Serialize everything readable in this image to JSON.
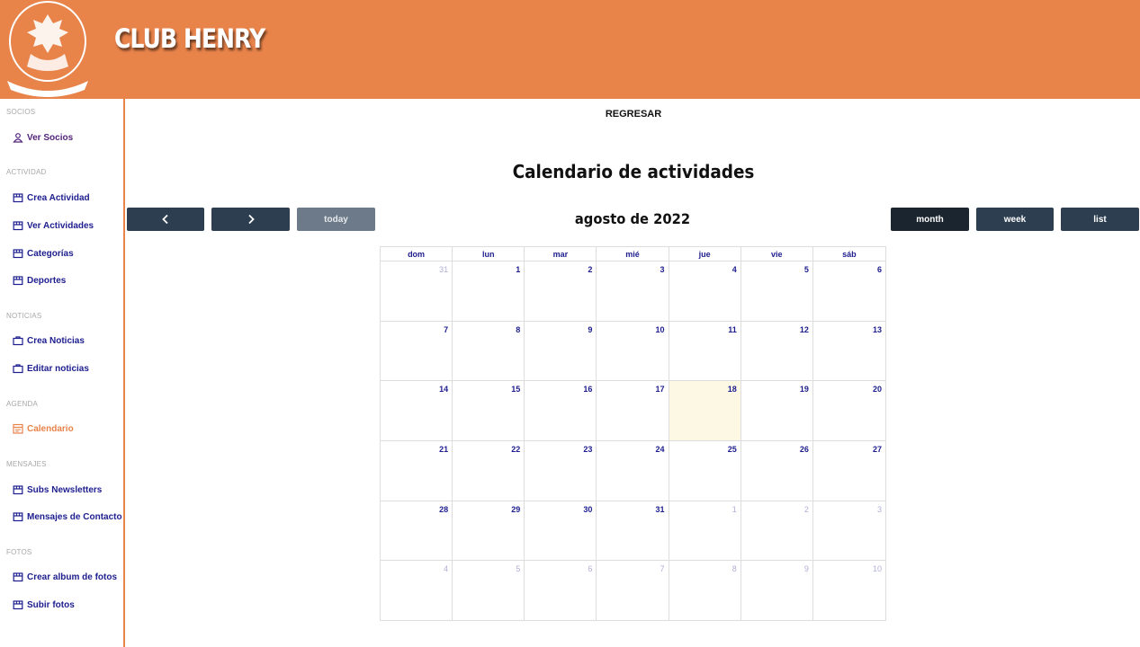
{
  "header": {
    "brand": "CLUB HENRY",
    "logo_text": "CLUB HENRY"
  },
  "sidebar": {
    "sections": [
      {
        "title": "SOCIOS",
        "items": [
          {
            "label": "Ver Socios",
            "icon": "user-icon"
          }
        ]
      },
      {
        "title": "ACTIVIDAD",
        "items": [
          {
            "label": "Crea Actividad",
            "icon": "store-icon"
          },
          {
            "label": "Ver Actividades",
            "icon": "store-icon"
          },
          {
            "label": "Categorías",
            "icon": "store-icon"
          },
          {
            "label": "Deportes",
            "icon": "store-icon"
          }
        ]
      },
      {
        "title": "NOTICIAS",
        "items": [
          {
            "label": "Crea Noticias",
            "icon": "briefcase-icon"
          },
          {
            "label": "Editar noticias",
            "icon": "briefcase-icon"
          }
        ]
      },
      {
        "title": "AGENDA",
        "items": [
          {
            "label": "Calendario",
            "icon": "calendar-icon",
            "active": true
          }
        ]
      },
      {
        "title": "MENSAJES",
        "items": [
          {
            "label": "Subs Newsletters",
            "icon": "store-icon"
          },
          {
            "label": "Mensajes de Contacto",
            "icon": "store-icon"
          }
        ]
      },
      {
        "title": "FOTOS",
        "items": [
          {
            "label": "Crear album de fotos",
            "icon": "store-icon"
          },
          {
            "label": "Subir fotos",
            "icon": "store-icon"
          }
        ]
      }
    ]
  },
  "main": {
    "back_label": "REGRESAR",
    "title": "Calendario de actividades",
    "toolbar": {
      "prev_icon": "chevron-left-icon",
      "next_icon": "chevron-right-icon",
      "today_label": "today",
      "month_label": "agosto de 2022",
      "views": [
        "month",
        "week",
        "list"
      ],
      "active_view": "month"
    },
    "calendar": {
      "weekdays": [
        "dom",
        "lun",
        "mar",
        "mié",
        "jue",
        "vie",
        "sáb"
      ],
      "today": 18,
      "weeks": [
        [
          {
            "d": "31",
            "o": true
          },
          {
            "d": "1"
          },
          {
            "d": "2"
          },
          {
            "d": "3"
          },
          {
            "d": "4"
          },
          {
            "d": "5"
          },
          {
            "d": "6"
          }
        ],
        [
          {
            "d": "7"
          },
          {
            "d": "8"
          },
          {
            "d": "9"
          },
          {
            "d": "10"
          },
          {
            "d": "11"
          },
          {
            "d": "12"
          },
          {
            "d": "13"
          }
        ],
        [
          {
            "d": "14"
          },
          {
            "d": "15"
          },
          {
            "d": "16"
          },
          {
            "d": "17"
          },
          {
            "d": "18"
          },
          {
            "d": "19"
          },
          {
            "d": "20"
          }
        ],
        [
          {
            "d": "21"
          },
          {
            "d": "22"
          },
          {
            "d": "23"
          },
          {
            "d": "24"
          },
          {
            "d": "25"
          },
          {
            "d": "26"
          },
          {
            "d": "27"
          }
        ],
        [
          {
            "d": "28"
          },
          {
            "d": "29"
          },
          {
            "d": "30"
          },
          {
            "d": "31"
          },
          {
            "d": "1",
            "o": true
          },
          {
            "d": "2",
            "o": true
          },
          {
            "d": "3",
            "o": true
          }
        ],
        [
          {
            "d": "4",
            "o": true
          },
          {
            "d": "5",
            "o": true
          },
          {
            "d": "6",
            "o": true
          },
          {
            "d": "7",
            "o": true
          },
          {
            "d": "8",
            "o": true
          },
          {
            "d": "9",
            "o": true
          },
          {
            "d": "10",
            "o": true
          }
        ]
      ]
    }
  },
  "colors": {
    "brand": "#e8834a",
    "nav_text": "#1d1d8f",
    "button": "#2c3e50",
    "today_cell": "#fcf8e3"
  }
}
